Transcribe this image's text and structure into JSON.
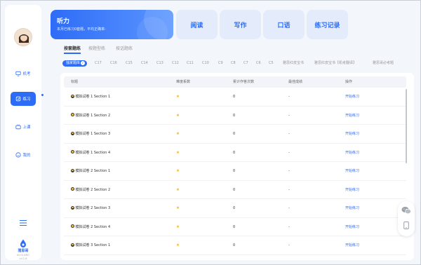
{
  "sidebar": {
    "items": [
      {
        "label": "机考",
        "icon": "monitor-icon"
      },
      {
        "label": "练习",
        "icon": "practice-icon"
      },
      {
        "label": "上课",
        "icon": "tv-icon"
      },
      {
        "label": "我的",
        "icon": "smile-icon"
      }
    ],
    "brand_name": "雅思哥",
    "brand_sub": "IELTS BRO",
    "version": "v4.1.6"
  },
  "header": {
    "title": "听力",
    "subtitle": "本月已练习0套题，平均正确率-",
    "tabs": [
      "阅读",
      "写作",
      "口语",
      "练习记录"
    ]
  },
  "subtabs": {
    "items": [
      "按套题练",
      "按题型练",
      "按话题练"
    ],
    "active": 0
  },
  "filters": {
    "items": [
      "独家题库",
      "C17",
      "C16",
      "C15",
      "C14",
      "C13",
      "C12",
      "C11",
      "C10",
      "C9",
      "C8",
      "C7",
      "C6",
      "C5",
      "雅思红皮宝书",
      "雅思红皮宝书【机考翻译】",
      "雅思哥必考题"
    ],
    "active": 0
  },
  "table": {
    "columns": [
      "标题",
      "难度系数",
      "累计作答次数",
      "最佳成绩",
      "操作"
    ],
    "rows": [
      {
        "title": "模拟试卷 1 Section 1",
        "difficulty": "★",
        "attempts": "0",
        "best": "-",
        "action": "开始练习"
      },
      {
        "title": "模拟试卷 1 Section 2",
        "difficulty": "★",
        "attempts": "0",
        "best": "-",
        "action": "开始练习"
      },
      {
        "title": "模拟试卷 1 Section 3",
        "difficulty": "★",
        "attempts": "0",
        "best": "-",
        "action": "开始练习"
      },
      {
        "title": "模拟试卷 1 Section 4",
        "difficulty": "★",
        "attempts": "0",
        "best": "-",
        "action": "开始练习"
      },
      {
        "title": "模拟试卷 2 Section 1",
        "difficulty": "★",
        "attempts": "0",
        "best": "-",
        "action": "开始练习"
      },
      {
        "title": "模拟试卷 2 Section 2",
        "difficulty": "★",
        "attempts": "0",
        "best": "-",
        "action": "开始练习"
      },
      {
        "title": "模拟试卷 2 Section 3",
        "difficulty": "★",
        "attempts": "0",
        "best": "-",
        "action": "开始练习"
      },
      {
        "title": "模拟试卷 2 Section 4",
        "difficulty": "★",
        "attempts": "0",
        "best": "-",
        "action": "开始练习"
      },
      {
        "title": "模拟试卷 3 Section 1",
        "difficulty": "★",
        "attempts": "0",
        "best": "-",
        "action": "开始练习"
      }
    ]
  },
  "colors": {
    "accent": "#2d6cf6",
    "star": "#f5b400",
    "tab_bg": "#e4ecfc"
  },
  "float_icons": [
    "wechat-icon",
    "phone-icon"
  ]
}
